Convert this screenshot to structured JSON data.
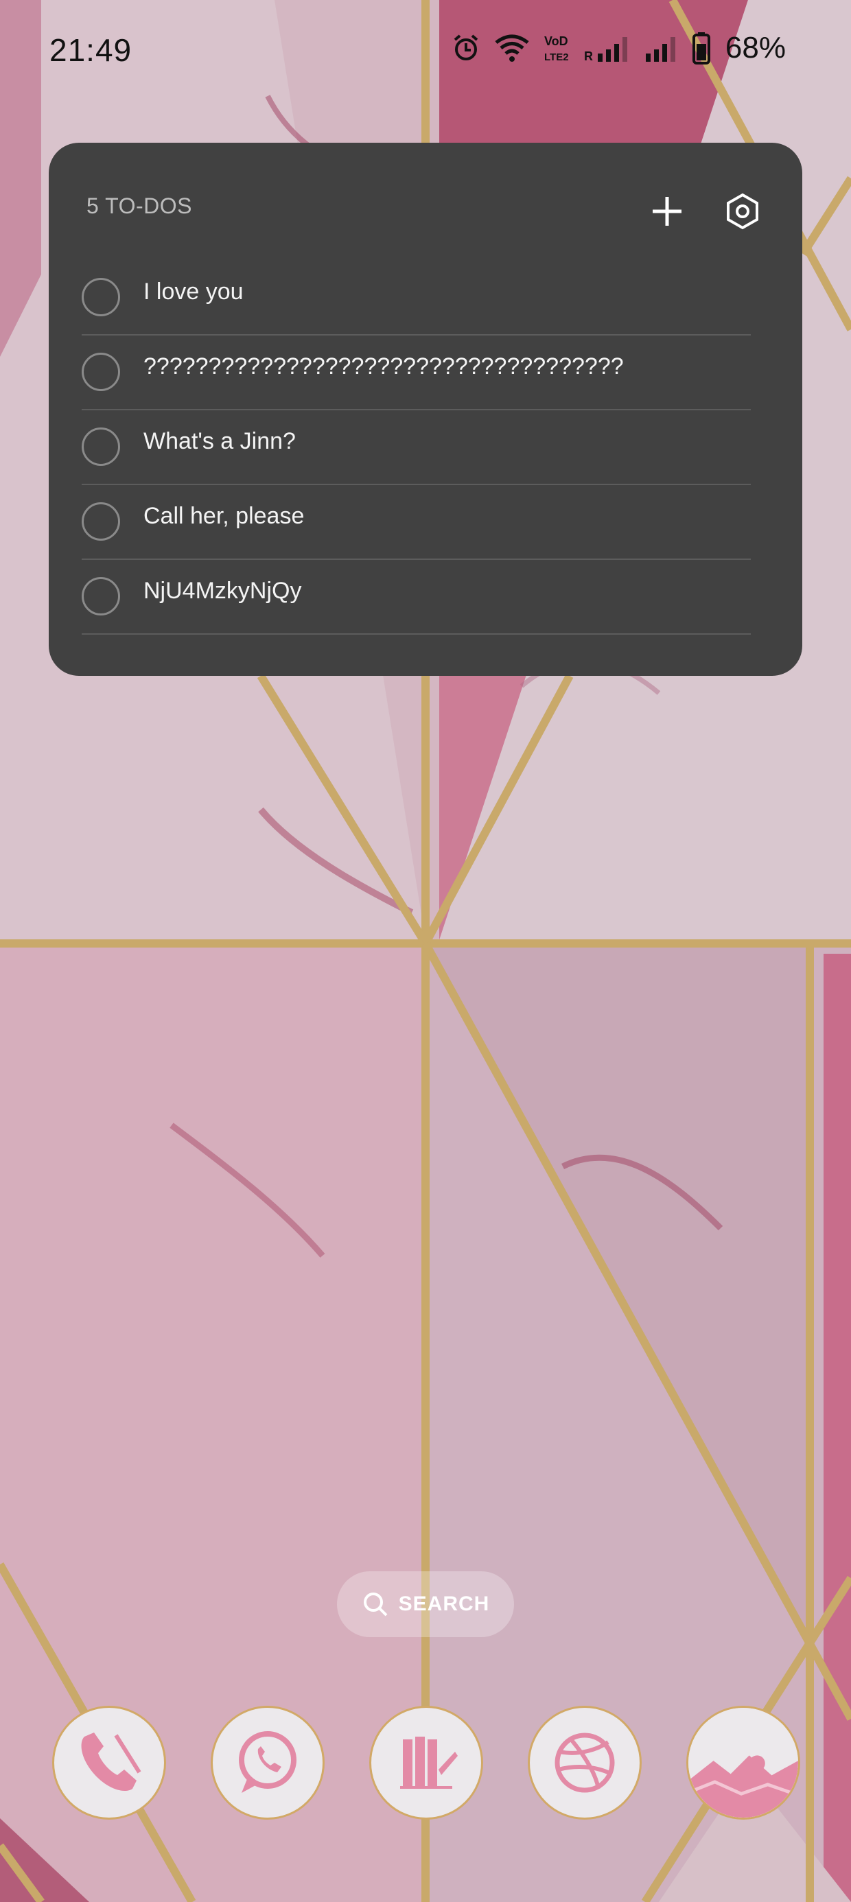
{
  "status_bar": {
    "time": "21:49",
    "battery_percent": "68%",
    "icons": [
      "alarm-icon",
      "wifi-icon",
      "volte-icon",
      "signal-roaming-icon",
      "signal-icon",
      "battery-icon"
    ]
  },
  "todo_widget": {
    "title": "5 TO-DOS",
    "add_icon": "plus-icon",
    "settings_icon": "settings-icon",
    "items": [
      {
        "text": "I love you",
        "done": false
      },
      {
        "text": "?????????????????????????????????????",
        "done": false
      },
      {
        "text": "What's a Jinn?",
        "done": false
      },
      {
        "text": "Call her, please",
        "done": false
      },
      {
        "text": "NjU4MzkyNjQy",
        "done": false
      }
    ]
  },
  "search": {
    "label": "SEARCH",
    "icon": "search-icon"
  },
  "dock": {
    "apps": [
      "phone-app-icon",
      "whatsapp-app-icon",
      "castle-app-icon",
      "dribbble-app-icon",
      "gallery-app-icon"
    ]
  },
  "colors": {
    "widget_bg": "#414141",
    "accent_pink": "#e38aa6",
    "gold_line": "#c9a96a"
  }
}
